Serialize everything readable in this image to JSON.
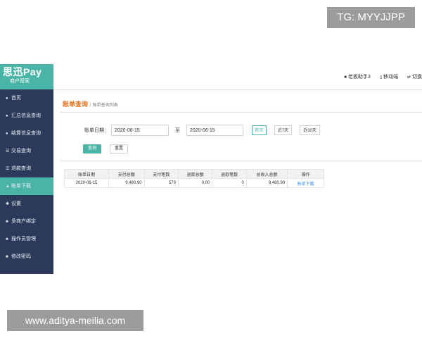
{
  "overlay": {
    "tg_text": "TG: MYYJJPP",
    "site_text": "www.aditya-meilia.com"
  },
  "brand": {
    "name": "思迅Pay",
    "subtitle": "商户管家",
    "color": "#4ab5a6"
  },
  "topbar": {
    "links": [
      {
        "label": "老板助手3",
        "icon": "user-icon"
      },
      {
        "label": "移动端",
        "icon": "mobile-icon"
      },
      {
        "label": "切换",
        "icon": "switch-icon"
      }
    ]
  },
  "sidebar": {
    "items": [
      {
        "label": "首页",
        "icon": "home-icon"
      },
      {
        "label": "汇总信息查询",
        "icon": "summary-icon"
      },
      {
        "label": "结算信息查询",
        "icon": "settlement-icon"
      },
      {
        "label": "交易查询",
        "icon": "list-icon"
      },
      {
        "label": "退款查询",
        "icon": "refund-icon"
      },
      {
        "label": "账单下载",
        "icon": "download-icon",
        "active": true
      },
      {
        "label": "设置",
        "icon": "settings-icon"
      },
      {
        "label": "多商户绑定",
        "icon": "merchants-icon"
      },
      {
        "label": "操作员管理",
        "icon": "operators-icon"
      },
      {
        "label": "修改密码",
        "icon": "lock-icon"
      }
    ]
  },
  "breadcrumb": {
    "main": "账单查询",
    "separator": "/",
    "sub": "账单查询列表"
  },
  "filter": {
    "date_label": "账单日期：",
    "start_date": "2020-06-15",
    "to_label": "至",
    "end_date": "2020-06-15",
    "quick": [
      "昨天",
      "近7天",
      "近30天"
    ],
    "search_label": "查询",
    "reset_label": "重置"
  },
  "table": {
    "columns": [
      "账单日期",
      "支付总额",
      "支付笔数",
      "退款总额",
      "退款笔数",
      "总收入总额",
      "操作"
    ],
    "rows": [
      {
        "date": "2020-06-15",
        "pay_total": "9,480.90",
        "pay_count": "579",
        "refund_total": "0.00",
        "refund_count": "0",
        "income_total": "9,480.90",
        "action": "账单下载"
      }
    ]
  }
}
